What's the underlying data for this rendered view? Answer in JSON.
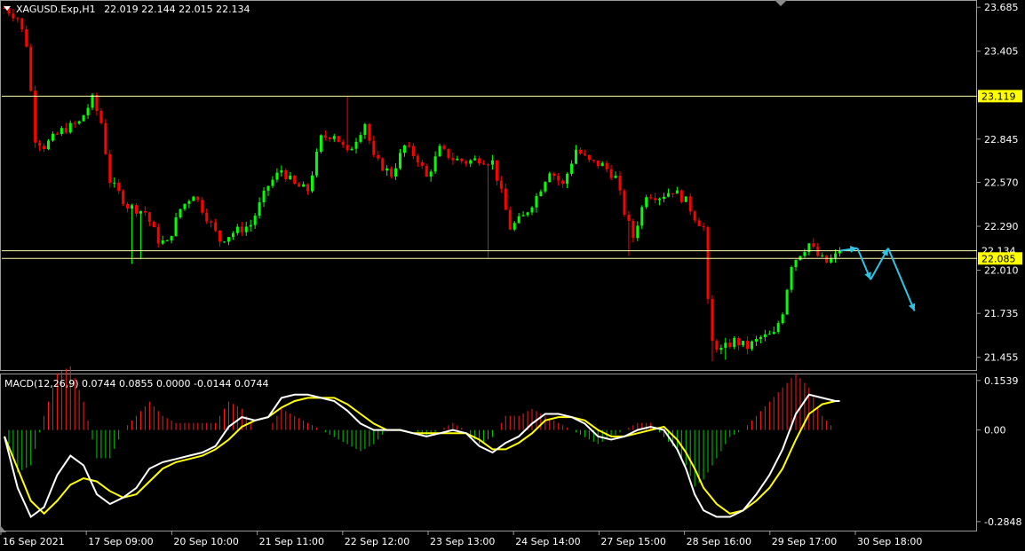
{
  "chart_data": [
    {
      "type": "candlestick",
      "symbol_header": "XAGUSD.Exp,H1",
      "ohlc_header": "22.019 22.144 22.015 22.134",
      "y_ticks": [
        "23.685",
        "23.405",
        "22.845",
        "22.570",
        "22.290",
        "22.010",
        "21.735",
        "21.455"
      ],
      "ylim": [
        21.38,
        23.72
      ],
      "h_lines": [
        {
          "value": 23.119,
          "label": "23.119",
          "label_bg": "#ffff00",
          "label_fg": "#000000"
        },
        {
          "value": 22.134,
          "label": "22.134",
          "label_bg": "#000000",
          "label_fg": "#ffffff"
        },
        {
          "value": 22.085,
          "label": "22.085",
          "label_bg": "#ffff00",
          "label_fg": "#000000"
        }
      ],
      "x_ticks": [
        "16 Sep 2021",
        "17 Sep 09:00",
        "20 Sep 10:00",
        "21 Sep 11:00",
        "22 Sep 12:00",
        "23 Sep 13:00",
        "24 Sep 14:00",
        "27 Sep 15:00",
        "28 Sep 16:00",
        "29 Sep 17:00",
        "30 Sep 18:00"
      ],
      "close_path": [
        [
          0,
          23.68
        ],
        [
          3,
          23.62
        ],
        [
          5,
          23.45
        ],
        [
          7,
          22.85
        ],
        [
          9,
          22.8
        ],
        [
          13,
          22.9
        ],
        [
          17,
          22.95
        ],
        [
          20,
          23.1
        ],
        [
          22,
          22.95
        ],
        [
          24,
          22.58
        ],
        [
          28,
          22.42
        ],
        [
          32,
          22.38
        ],
        [
          35,
          22.2
        ],
        [
          37,
          22.18
        ],
        [
          40,
          22.4
        ],
        [
          43,
          22.5
        ],
        [
          46,
          22.35
        ],
        [
          49,
          22.2
        ],
        [
          52,
          22.25
        ],
        [
          56,
          22.3
        ],
        [
          60,
          22.55
        ],
        [
          63,
          22.65
        ],
        [
          66,
          22.55
        ],
        [
          69,
          22.52
        ],
        [
          72,
          22.85
        ],
        [
          75,
          22.88
        ],
        [
          78,
          22.75
        ],
        [
          82,
          22.95
        ],
        [
          84,
          22.72
        ],
        [
          88,
          22.62
        ],
        [
          91,
          22.8
        ],
        [
          94,
          22.72
        ],
        [
          96,
          22.6
        ],
        [
          99,
          22.78
        ],
        [
          102,
          22.72
        ],
        [
          105,
          22.7
        ],
        [
          108,
          22.72
        ],
        [
          111,
          22.7
        ],
        [
          113,
          22.5
        ],
        [
          115,
          22.28
        ],
        [
          118,
          22.35
        ],
        [
          121,
          22.48
        ],
        [
          124,
          22.65
        ],
        [
          127,
          22.55
        ],
        [
          130,
          22.78
        ],
        [
          133,
          22.7
        ],
        [
          136,
          22.68
        ],
        [
          139,
          22.6
        ],
        [
          141,
          22.38
        ],
        [
          143,
          22.22
        ],
        [
          146,
          22.5
        ],
        [
          149,
          22.48
        ],
        [
          152,
          22.52
        ],
        [
          155,
          22.45
        ],
        [
          157,
          22.35
        ],
        [
          159,
          22.28
        ],
        [
          160,
          21.8
        ],
        [
          161,
          21.55
        ],
        [
          163,
          21.5
        ],
        [
          166,
          21.56
        ],
        [
          169,
          21.52
        ],
        [
          172,
          21.58
        ],
        [
          175,
          21.6
        ],
        [
          177,
          21.75
        ],
        [
          179,
          22.05
        ],
        [
          181,
          22.12
        ],
        [
          183,
          22.18
        ],
        [
          185,
          22.1
        ],
        [
          187,
          22.06
        ],
        [
          189,
          22.1
        ],
        [
          190,
          22.134
        ]
      ],
      "wicks": [
        {
          "bar": 29,
          "low": 22.05
        },
        {
          "bar": 31,
          "low": 22.08
        },
        {
          "bar": 78,
          "high": 23.12
        },
        {
          "bar": 110,
          "low": 22.09
        },
        {
          "bar": 142,
          "low": 22.1
        },
        {
          "bar": 161,
          "low": 21.43
        },
        {
          "bar": 164,
          "low": 21.44
        }
      ],
      "forecast_path": [
        [
          190,
          22.134
        ],
        [
          194,
          22.15
        ],
        [
          197,
          21.95
        ],
        [
          201,
          22.15
        ],
        [
          207,
          21.75
        ]
      ],
      "forecast_color": "#2ec4e6",
      "bull_color": "#00ff00",
      "bear_color": "#ff0000",
      "hline_color": "#ffffaa"
    },
    {
      "type": "macd",
      "header": "MACD(12,26,9) 0.0744 0.0855 0.0000 -0.0144 0.0744",
      "y_ticks": [
        "0.1539",
        "0.00",
        "-0.2848"
      ],
      "ylim": [
        -0.31,
        0.17
      ],
      "macd_path": [
        [
          0,
          -0.02
        ],
        [
          3,
          -0.18
        ],
        [
          6,
          -0.27
        ],
        [
          9,
          -0.24
        ],
        [
          12,
          -0.14
        ],
        [
          15,
          -0.08
        ],
        [
          18,
          -0.11
        ],
        [
          21,
          -0.2
        ],
        [
          24,
          -0.23
        ],
        [
          27,
          -0.21
        ],
        [
          30,
          -0.18
        ],
        [
          33,
          -0.12
        ],
        [
          36,
          -0.1
        ],
        [
          39,
          -0.09
        ],
        [
          42,
          -0.08
        ],
        [
          45,
          -0.07
        ],
        [
          48,
          -0.05
        ],
        [
          51,
          0.01
        ],
        [
          54,
          0.04
        ],
        [
          57,
          0.03
        ],
        [
          60,
          0.04
        ],
        [
          63,
          0.1
        ],
        [
          66,
          0.11
        ],
        [
          69,
          0.11
        ],
        [
          72,
          0.1
        ],
        [
          75,
          0.09
        ],
        [
          78,
          0.06
        ],
        [
          81,
          0.02
        ],
        [
          84,
          0.0
        ],
        [
          87,
          0.0
        ],
        [
          90,
          0.0
        ],
        [
          93,
          -0.01
        ],
        [
          96,
          -0.02
        ],
        [
          99,
          -0.01
        ],
        [
          102,
          0.0
        ],
        [
          105,
          -0.01
        ],
        [
          108,
          -0.05
        ],
        [
          111,
          -0.07
        ],
        [
          114,
          -0.04
        ],
        [
          117,
          -0.02
        ],
        [
          120,
          0.02
        ],
        [
          123,
          0.05
        ],
        [
          126,
          0.05
        ],
        [
          129,
          0.04
        ],
        [
          132,
          0.02
        ],
        [
          135,
          -0.02
        ],
        [
          138,
          -0.03
        ],
        [
          141,
          -0.02
        ],
        [
          144,
          0.0
        ],
        [
          147,
          0.01
        ],
        [
          150,
          0.0
        ],
        [
          153,
          -0.06
        ],
        [
          155,
          -0.12
        ],
        [
          157,
          -0.2
        ],
        [
          159,
          -0.25
        ],
        [
          162,
          -0.27
        ],
        [
          165,
          -0.27
        ],
        [
          168,
          -0.25
        ],
        [
          171,
          -0.2
        ],
        [
          174,
          -0.14
        ],
        [
          177,
          -0.06
        ],
        [
          180,
          0.05
        ],
        [
          183,
          0.11
        ],
        [
          186,
          0.1
        ],
        [
          189,
          0.09
        ],
        [
          190,
          0.09
        ]
      ],
      "signal_path": [
        [
          0,
          -0.02
        ],
        [
          3,
          -0.12
        ],
        [
          6,
          -0.22
        ],
        [
          9,
          -0.26
        ],
        [
          12,
          -0.22
        ],
        [
          15,
          -0.17
        ],
        [
          18,
          -0.15
        ],
        [
          21,
          -0.16
        ],
        [
          24,
          -0.19
        ],
        [
          27,
          -0.21
        ],
        [
          30,
          -0.2
        ],
        [
          33,
          -0.16
        ],
        [
          36,
          -0.12
        ],
        [
          39,
          -0.1
        ],
        [
          42,
          -0.09
        ],
        [
          45,
          -0.08
        ],
        [
          48,
          -0.06
        ],
        [
          51,
          -0.03
        ],
        [
          54,
          0.01
        ],
        [
          57,
          0.03
        ],
        [
          60,
          0.04
        ],
        [
          63,
          0.07
        ],
        [
          66,
          0.09
        ],
        [
          69,
          0.1
        ],
        [
          72,
          0.1
        ],
        [
          75,
          0.1
        ],
        [
          78,
          0.08
        ],
        [
          81,
          0.05
        ],
        [
          84,
          0.02
        ],
        [
          87,
          0.0
        ],
        [
          90,
          0.0
        ],
        [
          93,
          -0.01
        ],
        [
          96,
          -0.01
        ],
        [
          99,
          -0.01
        ],
        [
          102,
          -0.01
        ],
        [
          105,
          -0.01
        ],
        [
          108,
          -0.03
        ],
        [
          111,
          -0.06
        ],
        [
          114,
          -0.06
        ],
        [
          117,
          -0.04
        ],
        [
          120,
          -0.01
        ],
        [
          123,
          0.03
        ],
        [
          126,
          0.04
        ],
        [
          129,
          0.04
        ],
        [
          132,
          0.03
        ],
        [
          135,
          0.0
        ],
        [
          138,
          -0.02
        ],
        [
          141,
          -0.02
        ],
        [
          144,
          -0.01
        ],
        [
          147,
          0.0
        ],
        [
          150,
          0.01
        ],
        [
          153,
          -0.03
        ],
        [
          155,
          -0.07
        ],
        [
          157,
          -0.12
        ],
        [
          159,
          -0.18
        ],
        [
          162,
          -0.23
        ],
        [
          165,
          -0.26
        ],
        [
          168,
          -0.25
        ],
        [
          171,
          -0.22
        ],
        [
          174,
          -0.18
        ],
        [
          177,
          -0.12
        ],
        [
          180,
          -0.03
        ],
        [
          183,
          0.05
        ],
        [
          186,
          0.08
        ],
        [
          189,
          0.09
        ],
        [
          190,
          0.09
        ]
      ],
      "macd_color": "#ffffff",
      "signal_color": "#ffff00",
      "hist_pos_color": "#ff1a1a",
      "hist_neg_color": "#00cc00"
    }
  ]
}
